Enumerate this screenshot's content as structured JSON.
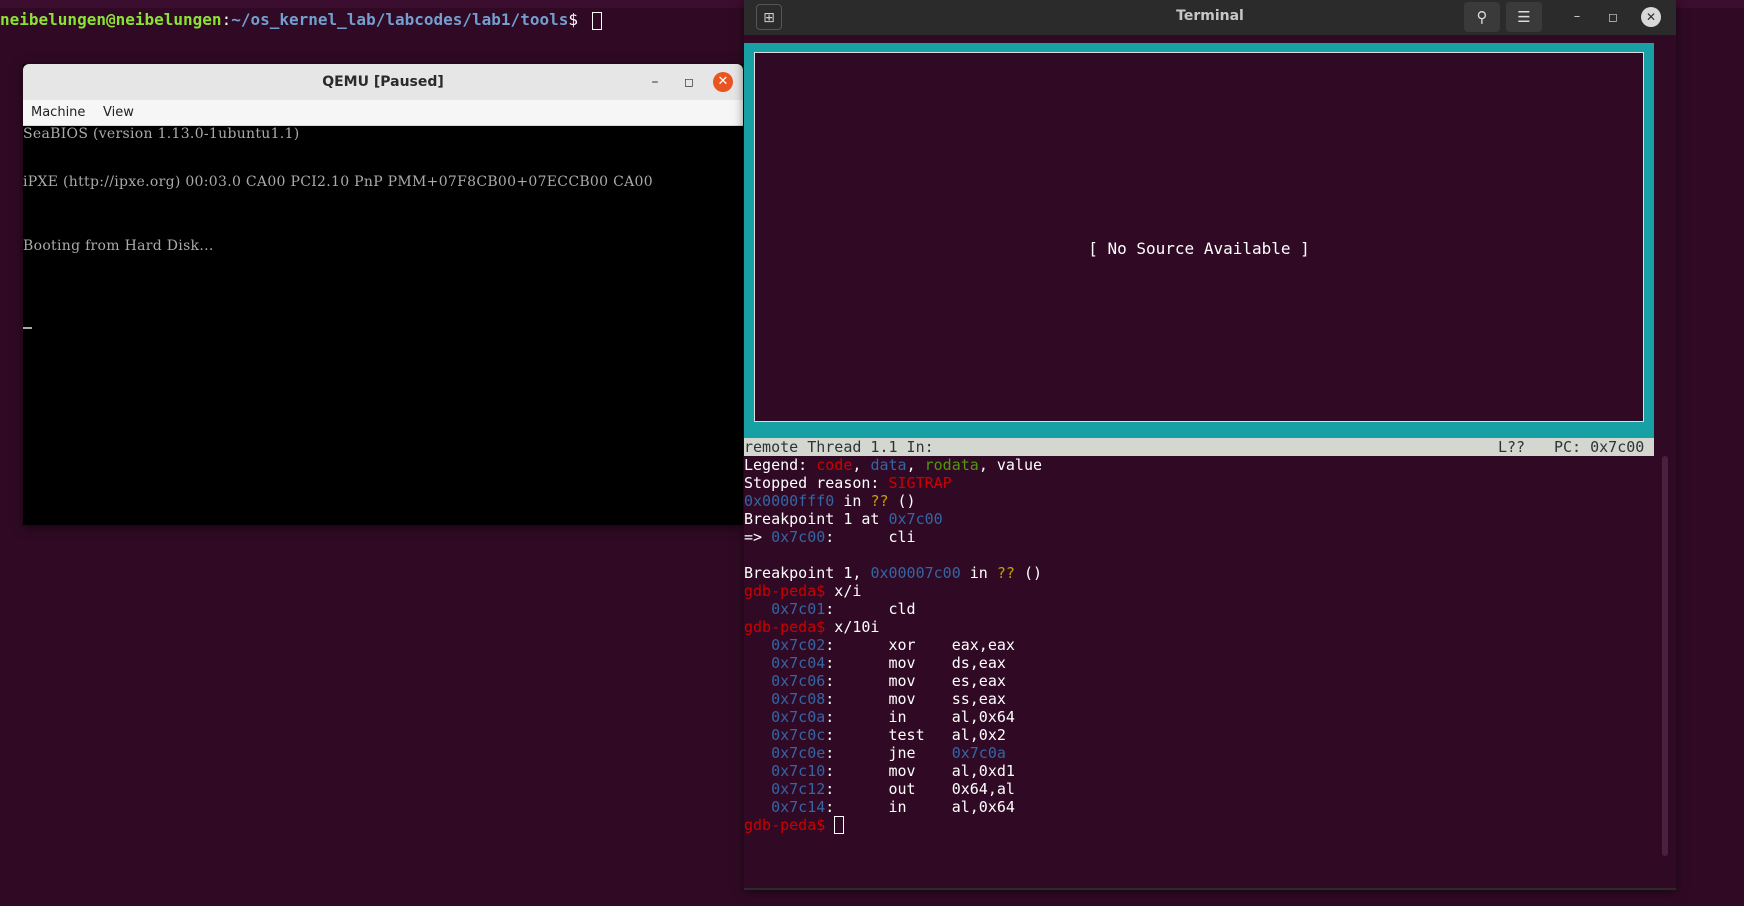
{
  "background_terminal": {
    "user_host": "neibelungen@neibelungen",
    "separator": ":",
    "path": "~/os_kernel_lab/labcodes/lab1/tools",
    "prompt_symbol": "$ "
  },
  "qemu": {
    "title": "QEMU [Paused]",
    "menu": [
      "Machine",
      "View"
    ],
    "screen_lines": [
      "SeaBIOS (version 1.13.0-1ubuntu1.1)",
      "iPXE (http://ipxe.org) 00:03.0 CA00 PCI2.10 PnP PMM+07F8CB00+07ECCB00 CA00",
      "Booting from Hard Disk..."
    ]
  },
  "terminal": {
    "title": "Terminal",
    "source_panel_text": "[ No Source Available ]",
    "status": {
      "left": "remote Thread 1.1 In:",
      "line": "L??",
      "pc": "PC: 0x7c00"
    },
    "legend": {
      "label": "Legend: ",
      "code": "code",
      "data": "data",
      "rodata": "rodata",
      "value": "value"
    },
    "stopped": {
      "label": "Stopped reason: ",
      "reason": "SIGTRAP"
    },
    "frame1": {
      "addr": "0x0000fff0",
      "mid": " in ",
      "func": "??",
      "tail": " ()"
    },
    "bp_set": {
      "label": "Breakpoint 1 at ",
      "addr": "0x7c00"
    },
    "current": {
      "arrow": "=> ",
      "addr": "0x7c00",
      "colon": ":",
      "instr": "cli"
    },
    "bp_hit": {
      "label": "Breakpoint 1, ",
      "addr": "0x00007c00",
      "mid": " in ",
      "func": "??",
      "tail": " ()"
    },
    "gdb_prompt": "gdb-peda$",
    "cmd1": " x/i",
    "cmd1_output": {
      "addr": "0x7c01",
      "mnemonic": "cld",
      "operands": ""
    },
    "cmd2": " x/10i",
    "disasm": [
      {
        "addr": "0x7c02",
        "mnemonic": "xor",
        "operands": "eax,eax"
      },
      {
        "addr": "0x7c04",
        "mnemonic": "mov",
        "operands": "ds,eax"
      },
      {
        "addr": "0x7c06",
        "mnemonic": "mov",
        "operands": "es,eax"
      },
      {
        "addr": "0x7c08",
        "mnemonic": "mov",
        "operands": "ss,eax"
      },
      {
        "addr": "0x7c0a",
        "mnemonic": "in",
        "operands": "al,0x64"
      },
      {
        "addr": "0x7c0c",
        "mnemonic": "test",
        "operands": "al,0x2"
      },
      {
        "addr": "0x7c0e",
        "mnemonic": "jne",
        "operands": "0x7c0a"
      },
      {
        "addr": "0x7c10",
        "mnemonic": "mov",
        "operands": "al,0xd1"
      },
      {
        "addr": "0x7c12",
        "mnemonic": "out",
        "operands": "0x64,al"
      },
      {
        "addr": "0x7c14",
        "mnemonic": "in",
        "operands": "al,0x64"
      }
    ]
  }
}
